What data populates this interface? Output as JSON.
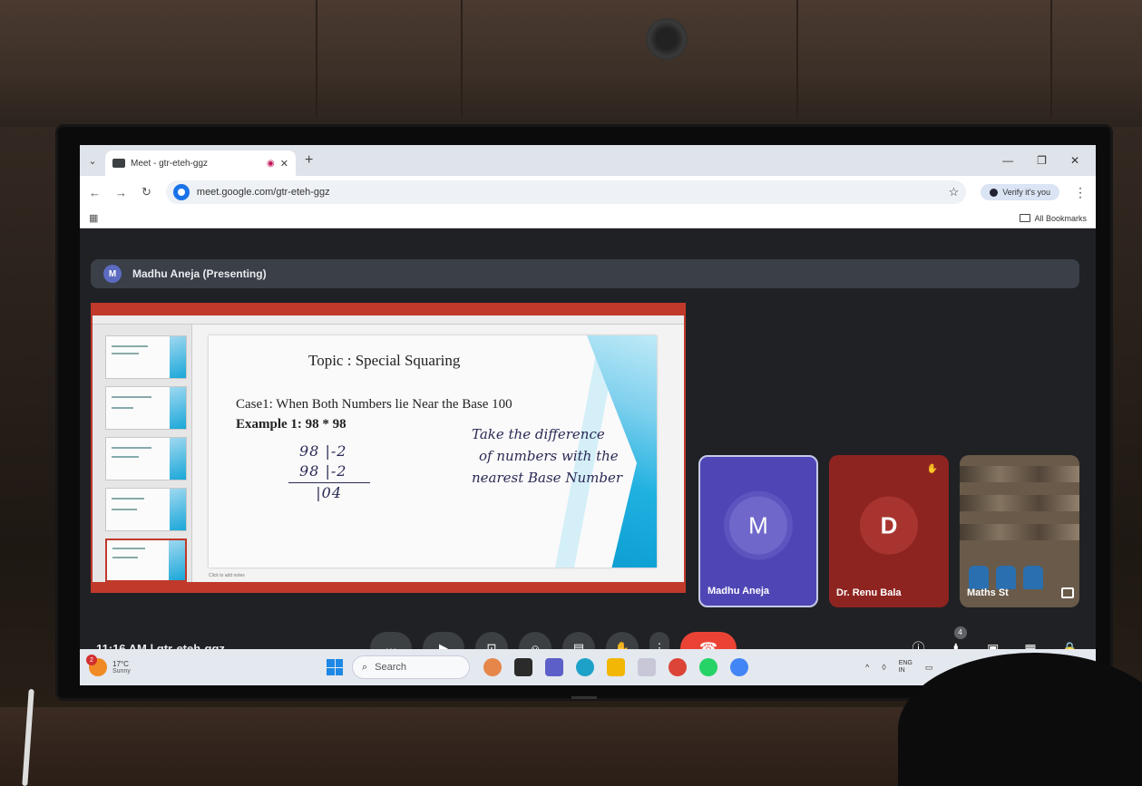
{
  "browser": {
    "tab_title": "Meet - gtr-eteh-ggz",
    "url": "meet.google.com/gtr-eteh-ggz",
    "verify_label": "Verify it's you",
    "all_bookmarks": "All Bookmarks"
  },
  "meet": {
    "presenter_initial": "M",
    "presenter_label": "Madhu Aneja (Presenting)",
    "time": "11:16 AM",
    "separator": "|",
    "meeting_code": "gtr-eteh-ggz",
    "people_count": "4"
  },
  "slide": {
    "title": "Topic : Special Squaring",
    "case": "Case1: When Both Numbers lie Near the Base 100",
    "example": "Example 1: 98 * 98",
    "hw_line1": "98 |-2",
    "hw_line2": "98 |-2",
    "hw_line3": "   |04",
    "hw_note1": "Take the difference",
    "hw_note2": "of numbers with the",
    "hw_note3": "nearest Base Number",
    "notes_hint": "Click to add notes"
  },
  "participants": [
    {
      "initial": "M",
      "name": "Madhu Aneja",
      "color": "#4f46b5"
    },
    {
      "initial": "D",
      "name": "Dr. Renu Bala",
      "color": "#8e2420"
    },
    {
      "initial": "",
      "name": "Maths St",
      "color": "#6a5a49"
    }
  ],
  "taskbar": {
    "weather_temp": "17°C",
    "weather_desc": "Sunny",
    "weather_badge": "2",
    "search_label": "Search",
    "lang_top": "ENG",
    "lang_bottom": "IN"
  },
  "colors": {
    "end_call": "#ea4335",
    "accent": "#1a73e8"
  }
}
